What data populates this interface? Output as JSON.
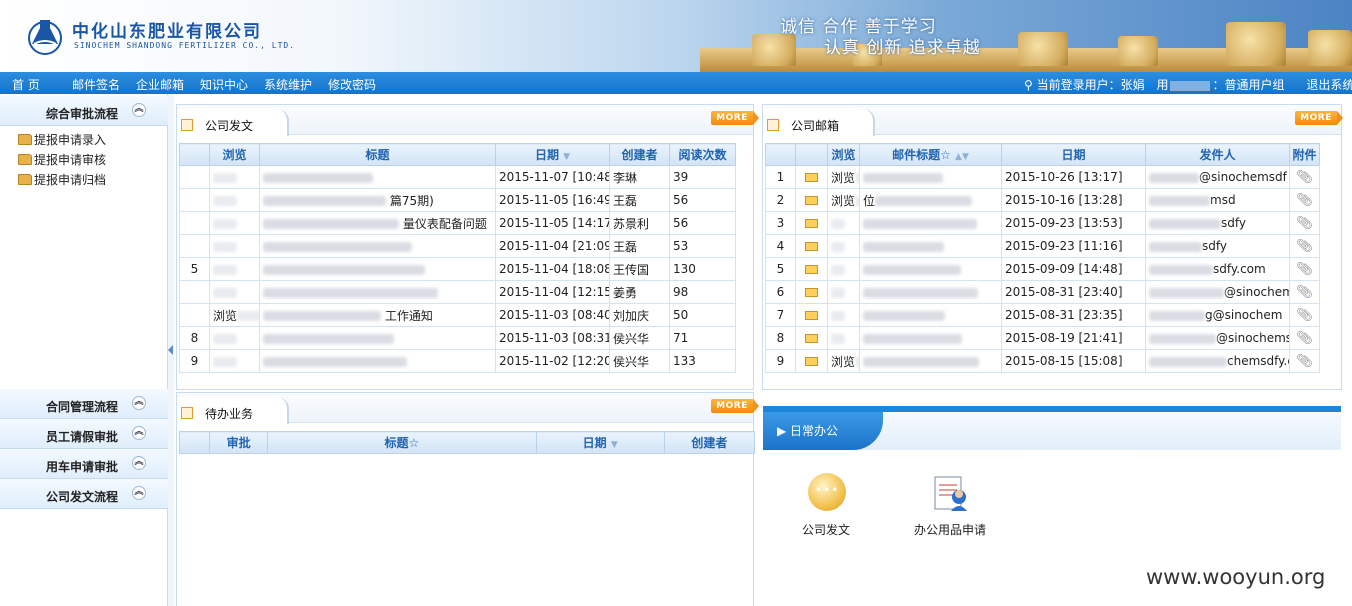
{
  "header": {
    "company_cn": "中化山东肥业有限公司",
    "company_en": "SINOCHEM SHANDONG FERTILIZER CO., LTD.",
    "slogan_line1": "诚信 合作 善于学习",
    "slogan_line2": "认真 创新 追求卓越"
  },
  "nav": {
    "items": [
      "首 页",
      "邮件签名",
      "企业邮箱",
      "知识中心",
      "系统维护",
      "修改密码"
    ],
    "current_user_label": "当前登录用户：张娟",
    "user_prefix": "用",
    "user_group": "：普通用户组",
    "logout": "退出系统"
  },
  "sidebar": {
    "sections": [
      {
        "label": "综合审批流程",
        "chevron": "︽"
      },
      {
        "label": "合同管理流程",
        "chevron": "︽"
      },
      {
        "label": "员工请假审批",
        "chevron": "︽"
      },
      {
        "label": "用车申请审批",
        "chevron": "︽"
      },
      {
        "label": "公司发文流程",
        "chevron": "︽"
      }
    ],
    "links": [
      "提报申请录入",
      "提报申请审核",
      "提报申请归档"
    ]
  },
  "company_docs": {
    "title": "公司发文",
    "more": "MORE",
    "columns": [
      "浏览",
      "标题",
      "日期",
      "创建者",
      "阅读次数"
    ],
    "rows": [
      {
        "num": "",
        "browse": "",
        "title_tail": "",
        "date": "2015-11-07 [10:48]",
        "creator": "李琳",
        "reads": "39"
      },
      {
        "num": "",
        "browse": "",
        "title_tail": "篇75期)",
        "date": "2015-11-05 [16:49]",
        "creator": "王磊",
        "reads": "56"
      },
      {
        "num": "",
        "browse": "",
        "title_tail": "量仪表配备问题",
        "date": "2015-11-05 [14:17]",
        "creator": "苏景利",
        "reads": "56"
      },
      {
        "num": "",
        "browse": "",
        "title_tail": "",
        "date": "2015-11-04 [21:09]",
        "creator": "王磊",
        "reads": "53"
      },
      {
        "num": "5",
        "browse": "",
        "title_tail": "",
        "date": "2015-11-04 [18:08]",
        "creator": "王传国",
        "reads": "130"
      },
      {
        "num": "",
        "browse": "",
        "title_tail": "",
        "date": "2015-11-04 [12:15]",
        "creator": "姜勇",
        "reads": "98"
      },
      {
        "num": "",
        "browse": "浏览",
        "title_tail": "工作通知",
        "date": "2015-11-03 [08:40]",
        "creator": "刘加庆",
        "reads": "50"
      },
      {
        "num": "8",
        "browse": "",
        "title_tail": "",
        "date": "2015-11-03 [08:31]",
        "creator": "侯兴华",
        "reads": "71"
      },
      {
        "num": "9",
        "browse": "",
        "title_tail": "",
        "date": "2015-11-02 [12:20]",
        "creator": "侯兴华",
        "reads": "133"
      }
    ]
  },
  "mailbox": {
    "title": "公司邮箱",
    "more": "MORE",
    "columns": [
      "浏览",
      "邮件标题☆",
      "日期",
      "发件人",
      "附件"
    ],
    "rows": [
      {
        "num": "1",
        "browse": "浏览",
        "subject": "",
        "date": "2015-10-26 [13:17]",
        "sender": "@sinochemsdf"
      },
      {
        "num": "2",
        "browse": "浏览",
        "subject": "位",
        "date": "2015-10-16 [13:28]",
        "sender": "msd"
      },
      {
        "num": "3",
        "browse": "",
        "subject": "",
        "date": "2015-09-23 [13:53]",
        "sender": "sdfy"
      },
      {
        "num": "4",
        "browse": "",
        "subject": "",
        "date": "2015-09-23 [11:16]",
        "sender": "sdfy"
      },
      {
        "num": "5",
        "browse": "",
        "subject": "",
        "date": "2015-09-09 [14:48]",
        "sender": "sdfy.com"
      },
      {
        "num": "6",
        "browse": "",
        "subject": "",
        "date": "2015-08-31 [23:40]",
        "sender": "@sinochem"
      },
      {
        "num": "7",
        "browse": "",
        "subject": "",
        "date": "2015-08-31 [23:35]",
        "sender": "g@sinochem"
      },
      {
        "num": "8",
        "browse": "",
        "subject": "",
        "date": "2015-08-19 [21:41]",
        "sender": "@sinochems"
      },
      {
        "num": "9",
        "browse": "浏览",
        "subject": "",
        "date": "2015-08-15 [15:08]",
        "sender": "chemsdfy.com"
      }
    ]
  },
  "todo": {
    "title": "待办业务",
    "more": "MORE",
    "columns": [
      "审批",
      "标题☆",
      "日期",
      "创建者"
    ]
  },
  "daily": {
    "title": "▶ 日常办公",
    "apps": [
      "公司发文",
      "办公用品申请"
    ]
  },
  "watermark": "www.wooyun.org"
}
